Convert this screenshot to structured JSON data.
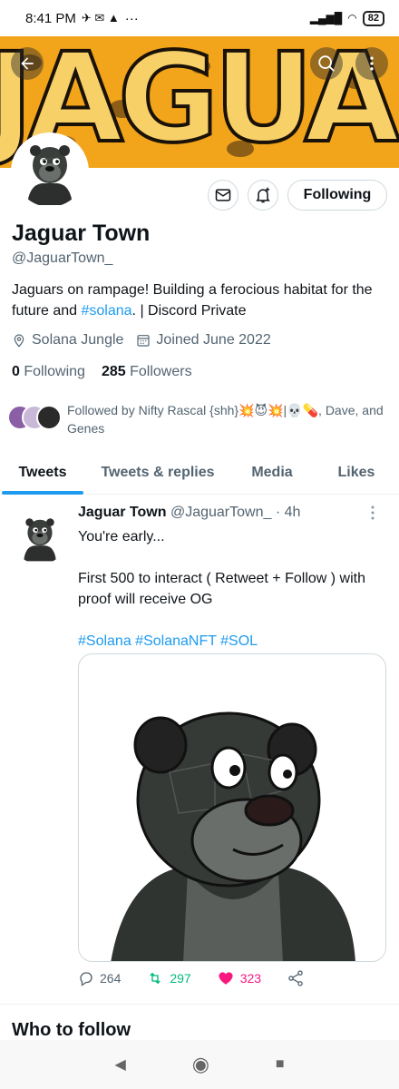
{
  "status_bar": {
    "time": "8:41 PM",
    "battery": "82",
    "dots": "···"
  },
  "banner": {
    "text": "JAGUAR"
  },
  "profile": {
    "name": "Jaguar Town",
    "handle": "@JaguarTown_",
    "bio_prefix": "Jaguars on rampage! Building a ferocious habitat for the future and ",
    "bio_hashtag": "#solana",
    "bio_suffix": ".  | Discord Private",
    "location": "Solana Jungle",
    "joined": "Joined June 2022",
    "following_count": "0",
    "following_label": "Following",
    "followers_count": "285",
    "followers_label": "Followers",
    "follow_button": "Following",
    "followed_by": "Followed by Nifty Rascal {shh}💥😈💥|💀💊, Dave, and Genes"
  },
  "tabs": [
    {
      "label": "Tweets",
      "active": true
    },
    {
      "label": "Tweets & replies",
      "active": false
    },
    {
      "label": "Media",
      "active": false
    },
    {
      "label": "Likes",
      "active": false
    }
  ],
  "tweet": {
    "author": "Jaguar Town",
    "handle": "@JaguarTown_",
    "separator": "·",
    "time": "4h",
    "line1": "You're early...",
    "line2": "First 500 to interact ( Retweet + Follow ) with proof will receive OG",
    "hashtags": "#Solana #SolanaNFT #SOL",
    "replies": "264",
    "retweets": "297",
    "likes": "323"
  },
  "who_to_follow": "Who to follow",
  "colors": {
    "accent": "#1d9bf0",
    "retweet": "#00ba7c",
    "like": "#f91880",
    "banner": "#f2a51a"
  },
  "icons": [
    "back-arrow-icon",
    "search-icon",
    "more-vertical-icon",
    "mail-icon",
    "bell-plus-icon",
    "location-icon",
    "calendar-icon",
    "reply-icon",
    "retweet-icon",
    "heart-icon",
    "share-icon"
  ]
}
